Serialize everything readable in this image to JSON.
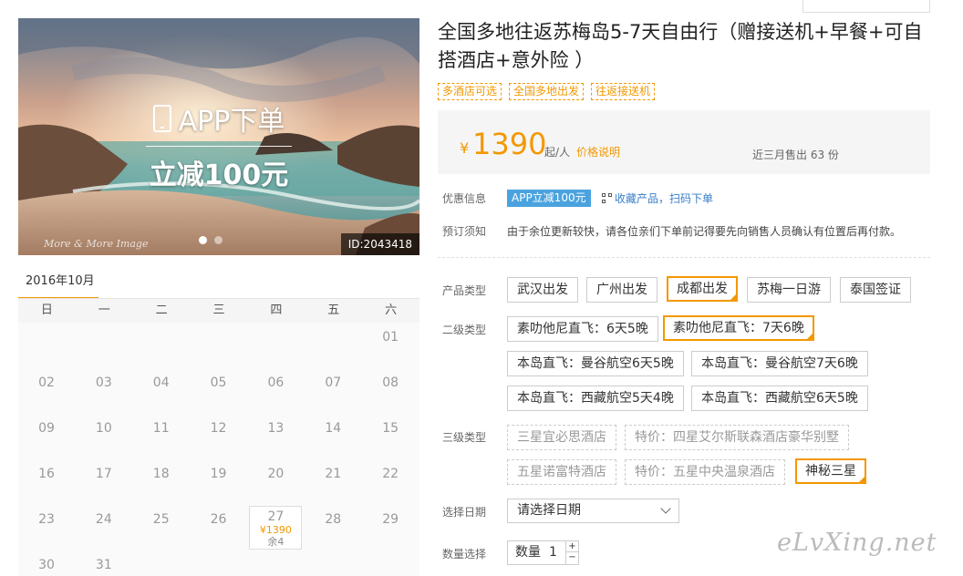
{
  "hero": {
    "app_text": "APP下单",
    "discount_text": "立减100元",
    "watermark": "More & More Image",
    "image_id": "ID:2043418"
  },
  "calendar": {
    "month": "2016年10月",
    "weekdays": [
      "日",
      "一",
      "二",
      "三",
      "四",
      "五",
      "六"
    ],
    "days": [
      "01",
      "02",
      "03",
      "04",
      "05",
      "06",
      "07",
      "08",
      "09",
      "10",
      "11",
      "12",
      "13",
      "14",
      "15",
      "16",
      "17",
      "18",
      "19",
      "20",
      "21",
      "22",
      "23",
      "24",
      "25",
      "26",
      "27",
      "28",
      "29",
      "30",
      "31"
    ],
    "priced_day": {
      "day": "27",
      "price": "¥1390",
      "stock": "余4"
    }
  },
  "product": {
    "title": "全国多地往返苏梅岛5-7天自由行（赠接送机+早餐+可自搭酒店+意外险 ）",
    "tags": [
      "多酒店可选",
      "全国多地出发",
      "往返接送机"
    ]
  },
  "price": {
    "currency": "¥",
    "amount": "1390",
    "unit": "起/人",
    "explain_link": "价格说明",
    "sold": "近三月售出 63 份"
  },
  "promo": {
    "label": "优惠信息",
    "badge": "APP立减100元",
    "collect_link": "收藏产品，扫码下单"
  },
  "notice": {
    "label": "预订须知",
    "text": "由于余位更新较快，请各位亲们下单前记得要先向销售人员确认有位置后再付款。"
  },
  "product_type": {
    "label": "产品类型",
    "options": [
      "武汉出发",
      "广州出发",
      "成都出发",
      "苏梅一日游",
      "泰国签证"
    ],
    "selected_index": 2
  },
  "level2": {
    "label": "二级类型",
    "options": [
      "素叻他尼直飞：6天5晚",
      "素叻他尼直飞：7天6晚",
      "本岛直飞：曼谷航空6天5晚",
      "本岛直飞：曼谷航空7天6晚",
      "本岛直飞：西藏航空5天4晚",
      "本岛直飞：西藏航空6天5晚"
    ],
    "selected_index": 1
  },
  "level3": {
    "label": "三级类型",
    "options": [
      "三星宜必思酒店",
      "特价：四星艾尔斯联森酒店豪华别墅",
      "五星诺富特酒店",
      "特价：五星中央温泉酒店",
      "神秘三星"
    ],
    "selected_index": 4
  },
  "date": {
    "label": "选择日期",
    "placeholder": "请选择日期"
  },
  "quantity": {
    "label": "数量选择",
    "field_label": "数量",
    "value": "1",
    "plus": "+",
    "minus": "−"
  },
  "site_watermark": "eLvXing.net"
}
